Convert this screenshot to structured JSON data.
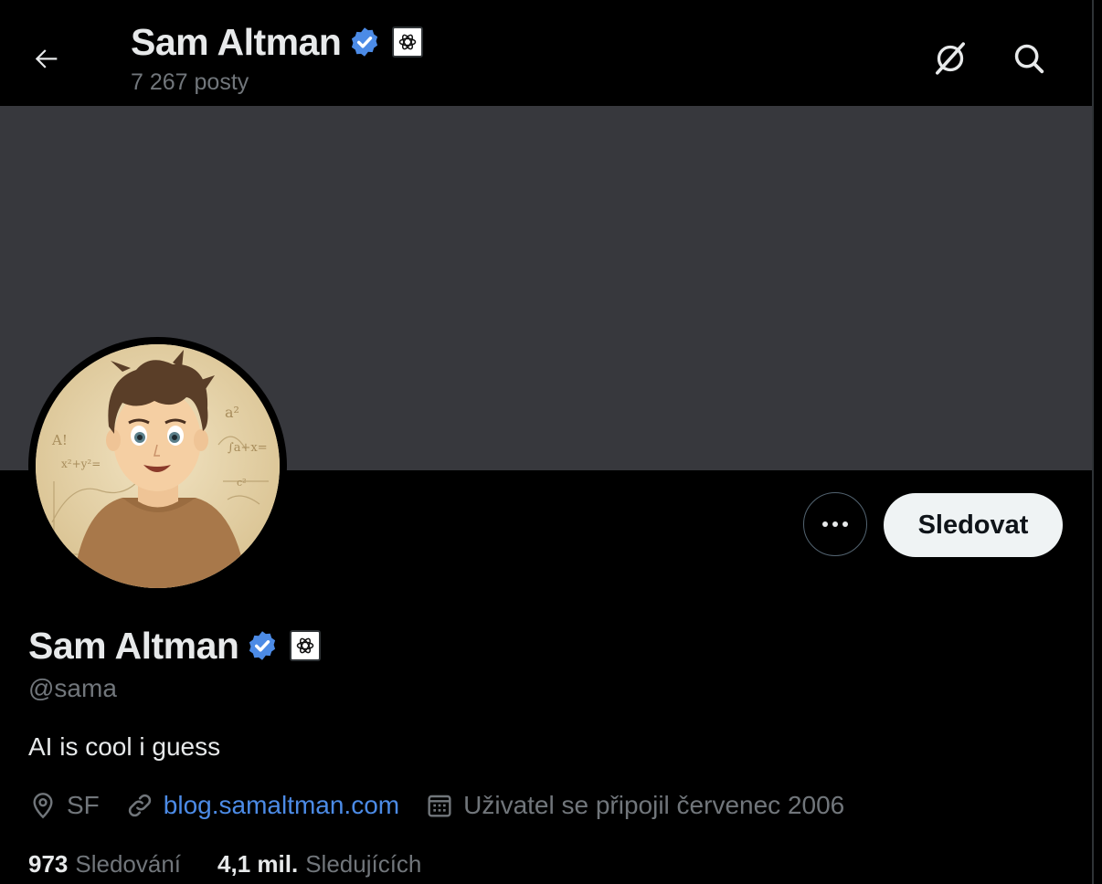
{
  "header": {
    "name": "Sam Altman",
    "post_count": "7 267 posty"
  },
  "profile": {
    "name": "Sam Altman",
    "handle": "@sama",
    "bio": "AI is cool i guess",
    "location": "SF",
    "website": "blog.samaltman.com",
    "joined": "Uživatel se připojil červenec 2006"
  },
  "actions": {
    "follow_label": "Sledovat"
  },
  "stats": {
    "following_count": "973",
    "following_label": "Sledování",
    "followers_count": "4,1 mil.",
    "followers_label": "Sledujících"
  },
  "icons": {
    "back": "arrow-left-icon",
    "grok": "grok-icon",
    "search": "search-icon",
    "verified": "verified-badge-icon",
    "affiliate": "openai-logo-icon",
    "more": "more-dots-icon",
    "location": "location-pin-icon",
    "link": "link-icon",
    "calendar": "calendar-icon"
  },
  "colors": {
    "background": "#000000",
    "banner": "#37383d",
    "verified": "#4c8be6",
    "link": "#4c8be6",
    "follow_button_bg": "#eff3f4",
    "secondary_text": "#71767b"
  }
}
